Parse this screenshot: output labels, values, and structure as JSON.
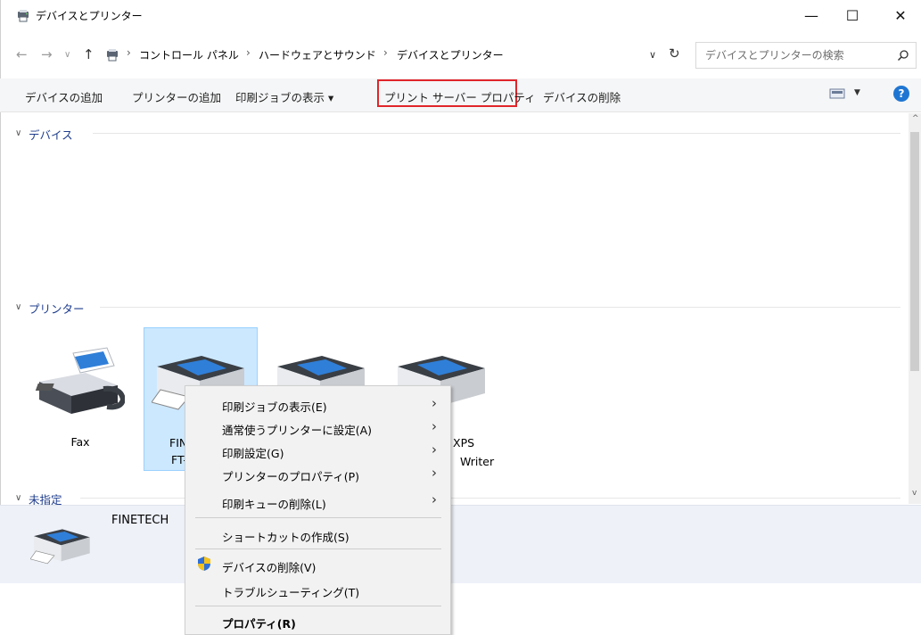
{
  "window": {
    "title": "デバイスとプリンター",
    "minimize_glyph": "—",
    "maximize_glyph": "☐",
    "close_glyph": "✕"
  },
  "nav": {
    "breadcrumb": [
      "コントロール パネル",
      "ハードウェアとサウンド",
      "デバイスとプリンター"
    ],
    "separator": "›",
    "search_placeholder": "デバイスとプリンターの検索"
  },
  "toolbar": {
    "add_device": "デバイスの追加",
    "add_printer": "プリンターの追加",
    "see_print_jobs": "印刷ジョブの表示 ▾",
    "print_server_props": "プリント サーバー プロパティ",
    "remove_device": "デバイスの削除",
    "help": "?"
  },
  "groups": {
    "devices": "デバイス",
    "printers": "プリンター",
    "unspecified": "未指定"
  },
  "printers": [
    {
      "name": "Fax",
      "icon": "fax-icon"
    },
    {
      "name_line1": "FIN",
      "name_line2": "FT-",
      "icon": "printer-icon"
    },
    {
      "name": "",
      "icon": "printer-icon"
    },
    {
      "name_line1": "XPS",
      "name_line2": "Writer",
      "icon": "printer-icon"
    }
  ],
  "details": {
    "device_name": "FINETECH"
  },
  "context_menu": {
    "items": [
      {
        "label": "印刷ジョブの表示(E)",
        "submenu": true
      },
      {
        "label": "通常使うプリンターに設定(A)",
        "submenu": true
      },
      {
        "label": "印刷設定(G)",
        "submenu": true
      },
      {
        "label": "プリンターのプロパティ(P)",
        "submenu": true
      },
      {
        "label": "印刷キューの削除(L)",
        "submenu": true
      },
      {
        "label": "ショートカットの作成(S)",
        "submenu": false
      },
      {
        "label": "デバイスの削除(V)",
        "submenu": false,
        "icon": "uac-shield-icon"
      },
      {
        "label": "トラブルシューティング(T)",
        "submenu": false
      },
      {
        "label": "プロパティ(R)",
        "submenu": false,
        "bold": true
      }
    ]
  },
  "colors": {
    "accent": "#1f76d2",
    "highlight_border": "#e0252a",
    "selection_fill": "#cce8ff",
    "group_label": "#1e3c8c"
  }
}
